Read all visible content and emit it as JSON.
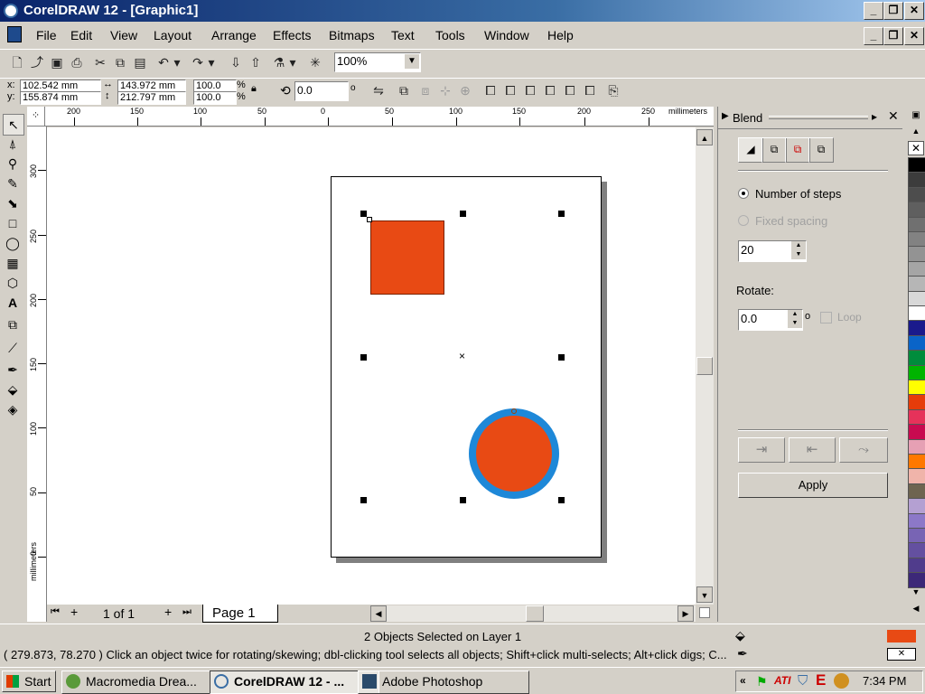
{
  "window": {
    "title": "CorelDRAW 12 - [Graphic1]"
  },
  "menu": [
    "File",
    "Edit",
    "View",
    "Layout",
    "Arrange",
    "Effects",
    "Bitmaps",
    "Text",
    "Tools",
    "Window",
    "Help"
  ],
  "toolbar": {
    "zoom": "100%"
  },
  "propbar": {
    "x_label": "x:",
    "x": "102.542 mm",
    "y_label": "y:",
    "y": "155.874 mm",
    "w": "143.972 mm",
    "h": "212.797 mm",
    "sx": "100.0",
    "sy": "100.0",
    "pct": "%",
    "angle": "0.0",
    "deg": "o"
  },
  "ruler": {
    "h_ticks": [
      "200",
      "150",
      "100",
      "50",
      "0",
      "50",
      "100",
      "150",
      "200",
      "250"
    ],
    "unit": "millimeters",
    "v_ticks": [
      "300",
      "250",
      "200",
      "150",
      "100",
      "50",
      "0"
    ],
    "v_unit": "millimeters"
  },
  "page_nav": {
    "count": "1 of 1",
    "tab": "Page 1"
  },
  "docker": {
    "title": "Blend",
    "number_of_steps": "Number of steps",
    "fixed_spacing": "Fixed spacing",
    "steps": "20",
    "rotate_label": "Rotate:",
    "rotate": "0.0",
    "deg": "o",
    "loop": "Loop",
    "apply": "Apply"
  },
  "palette": [
    "#ffffff",
    "#000000",
    "#3c3c3c",
    "#4d4d4d",
    "#5f5f5f",
    "#707070",
    "#828282",
    "#939393",
    "#a5a5a5",
    "#b6b6b6",
    "#d8d8d8",
    "#ffffff",
    "#1a1a8c",
    "#0a64c8",
    "#008c3c",
    "#00b400",
    "#ffff00",
    "#e63c0a",
    "#e6325a",
    "#c80a50",
    "#e6a0b4",
    "#ff7800",
    "#f0b4aa",
    "#6e6450",
    "#b4a0d2",
    "#8c78c8",
    "#7864b4",
    "#6450a0",
    "#503c8c",
    "#3c2878"
  ],
  "status": {
    "selection": "2 Objects Selected on Layer 1",
    "hint": "( 279.873, 78.270 ) Click an object twice for rotating/skewing; dbl-clicking tool selects all objects; Shift+click multi-selects; Alt+click digs; C...",
    "fill_color": "#e84a14"
  },
  "taskbar": {
    "start": "Start",
    "tasks": [
      "Macromedia Drea...",
      "CorelDRAW 12 - ...",
      "Adobe Photoshop"
    ],
    "clock": "7:34 PM"
  },
  "shapes": {
    "fill": "#e84a14",
    "outline": "#1e88d8"
  }
}
